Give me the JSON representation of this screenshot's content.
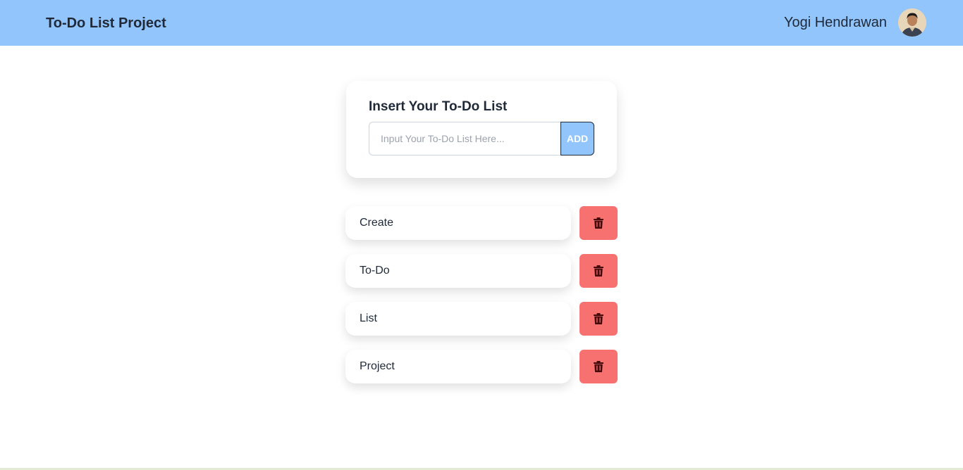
{
  "navbar": {
    "brand": "To-Do List Project",
    "user_name": "Yogi Hendrawan"
  },
  "form": {
    "title": "Insert Your To-Do List",
    "input_placeholder": "Input Your To-Do List Here...",
    "input_value": "",
    "add_label": "ADD"
  },
  "todos": [
    "Create",
    "To-Do",
    "List",
    "Project"
  ],
  "icons": {
    "delete": "trash-icon",
    "avatar": "user-avatar"
  },
  "colors": {
    "navbar": "#93c5fd",
    "add_button": "#93c5fd",
    "delete_button": "#f87171",
    "delete_icon": "#450a0a"
  }
}
